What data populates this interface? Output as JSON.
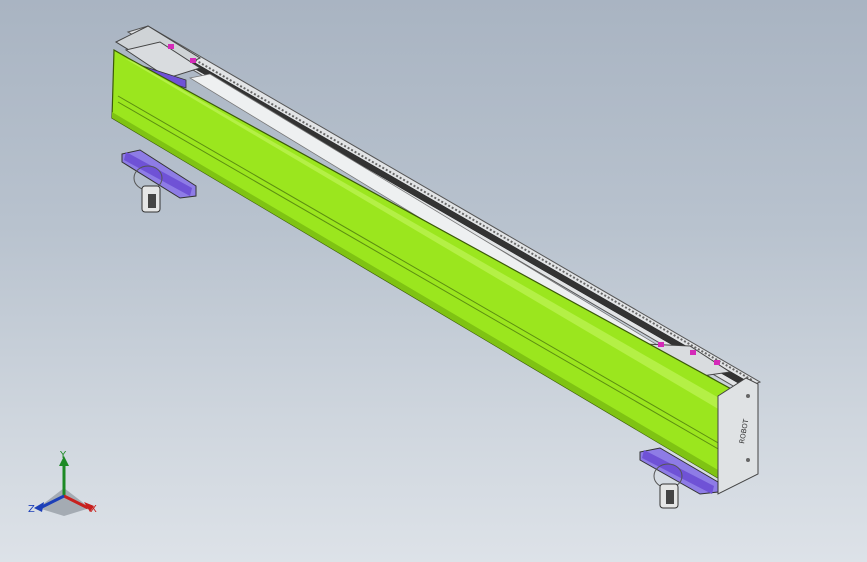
{
  "viewport": {
    "background_top": "#a9b4c2",
    "background_bottom": "#dde2e8"
  },
  "model": {
    "cover_color": "#9be61e",
    "cover_shadow": "#7fc313",
    "frame_color": "#d7dadd",
    "carriage_color": "#6f52d6",
    "marker_color": "#d42ab8",
    "end_plate_logo": "ROBOT"
  },
  "triad": {
    "x_label": "X",
    "y_label": "Y",
    "z_label": "Z",
    "x_color": "#c8201e",
    "y_color": "#1d8a25",
    "z_color": "#1c3fb8"
  }
}
